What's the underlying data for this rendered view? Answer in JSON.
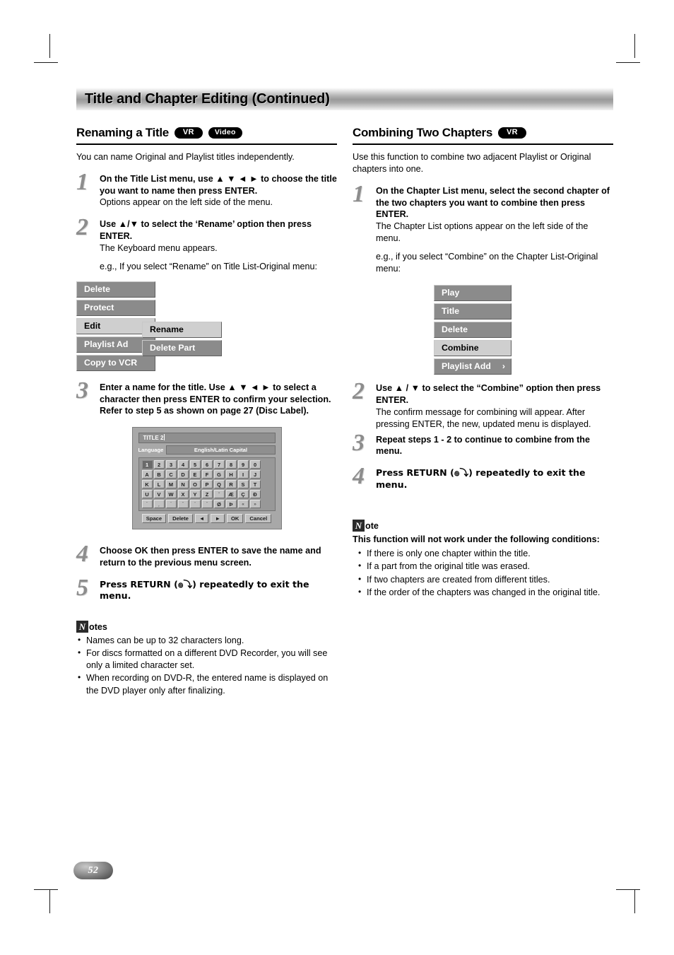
{
  "header": {
    "title": "Title and Chapter Editing (Continued)"
  },
  "page": {
    "number": "52"
  },
  "left": {
    "heading": "Renaming a Title",
    "badges": [
      "VR",
      "Video"
    ],
    "intro": "You can name Original and Playlist titles independently.",
    "steps": [
      {
        "num": "1",
        "lead": "On the Title List menu, use ▲ ▼ ◄ ► to choose the title you want to name then press ENTER.",
        "sub": "Options appear on the left side of the menu."
      },
      {
        "num": "2",
        "lead": "Use ▲/▼ to select the ‘Rename’ option then press ENTER.",
        "sub": "The Keyboard menu appears.",
        "extra": "e.g., If you select “Rename” on Title List-Original menu:"
      },
      {
        "num": "3",
        "lead": "Enter a name for the title. Use ▲ ▼ ◄ ► to select a character then press ENTER to confirm your selection. Refer to step 5 as shown on page 27 (Disc Label)."
      },
      {
        "num": "4",
        "lead": "Choose OK then press ENTER to save the name and return to the previous menu screen."
      },
      {
        "num": "5",
        "lead": "Press RETURN (๏⤵) repeatedly to exit the menu."
      }
    ],
    "osd_menu": {
      "main": [
        {
          "label": "Delete",
          "selected": false
        },
        {
          "label": "Protect",
          "selected": false
        },
        {
          "label": "Edit",
          "selected": true
        },
        {
          "label": "Playlist Ad",
          "selected": false
        },
        {
          "label": "Copy to VCR",
          "selected": false
        }
      ],
      "submenu": [
        {
          "label": "Rename",
          "selected": true
        },
        {
          "label": "Delete Part",
          "selected": false
        }
      ]
    },
    "keyboard": {
      "title_value": "TITLE 2",
      "language_label": "Language",
      "language_value": "English/Latin Capital",
      "rows": [
        [
          "1",
          "2",
          "3",
          "4",
          "5",
          "6",
          "7",
          "8",
          "9",
          "0"
        ],
        [
          "A",
          "B",
          "C",
          "D",
          "E",
          "F",
          "G",
          "H",
          "I",
          "J"
        ],
        [
          "K",
          "L",
          "M",
          "N",
          "O",
          "P",
          "Q",
          "R",
          "S",
          "T"
        ],
        [
          "U",
          "V",
          "W",
          "X",
          "Y",
          "Z",
          "ʹ",
          "Æ",
          "Ç",
          "Ð"
        ],
        [
          "´",
          "¸",
          "ˋ",
          "ˉ",
          "¨",
          "ˉ",
          "Ø",
          "Þ",
          "«",
          "»"
        ]
      ],
      "current_key": "1",
      "buttons": [
        "Space",
        "Delete",
        "◄",
        "►",
        "OK",
        "Cancel"
      ]
    },
    "notes": {
      "icon": "N",
      "word": "otes",
      "items": [
        "Names can be up to 32 characters long.",
        "For discs formatted on a different DVD Recorder, you will see only a limited character set.",
        "When recording on DVD-R, the entered name is displayed on the DVD player only after finalizing."
      ]
    }
  },
  "right": {
    "heading": "Combining Two Chapters",
    "badges": [
      "VR"
    ],
    "intro": "Use this function to combine two adjacent Playlist or Original chapters into one.",
    "steps": [
      {
        "num": "1",
        "lead": "On the Chapter List menu, select the second chapter of the two chapters you want to combine then press ENTER.",
        "sub": "The Chapter List options appear on the left side of the menu.",
        "extra": "e.g., if you select “Combine” on the Chapter List-Original menu:"
      },
      {
        "num": "2",
        "lead": "Use ▲ / ▼ to select the “Combine” option then press ENTER.",
        "sub": "The confirm message for combining will appear. After pressing ENTER, the new, updated menu is displayed."
      },
      {
        "num": "3",
        "lead": "Repeat steps 1 - 2 to continue to combine from the menu."
      },
      {
        "num": "4",
        "lead": "Press RETURN (๏⤵) repeatedly to exit the menu."
      }
    ],
    "osd_menu": [
      {
        "label": "Play",
        "selected": false,
        "arrow": ""
      },
      {
        "label": "Title",
        "selected": false,
        "arrow": ""
      },
      {
        "label": "Delete",
        "selected": false,
        "arrow": ""
      },
      {
        "label": "Combine",
        "selected": true,
        "arrow": ""
      },
      {
        "label": "Playlist Add",
        "selected": false,
        "arrow": "›"
      }
    ],
    "note": {
      "icon": "N",
      "word": "ote",
      "lead": "This function will not work under the following conditions:",
      "items": [
        "If there is only one chapter within the title.",
        "If a part from the original title was erased.",
        "If two chapters are created from different titles.",
        "If the order of the chapters was changed in the original title."
      ]
    }
  },
  "colors": {
    "menu_normal_bg": "#8b8b8b",
    "menu_selected_bg": "#cfcfcf",
    "badge_bg": "#000000",
    "step_number": "#8d8d8d"
  }
}
